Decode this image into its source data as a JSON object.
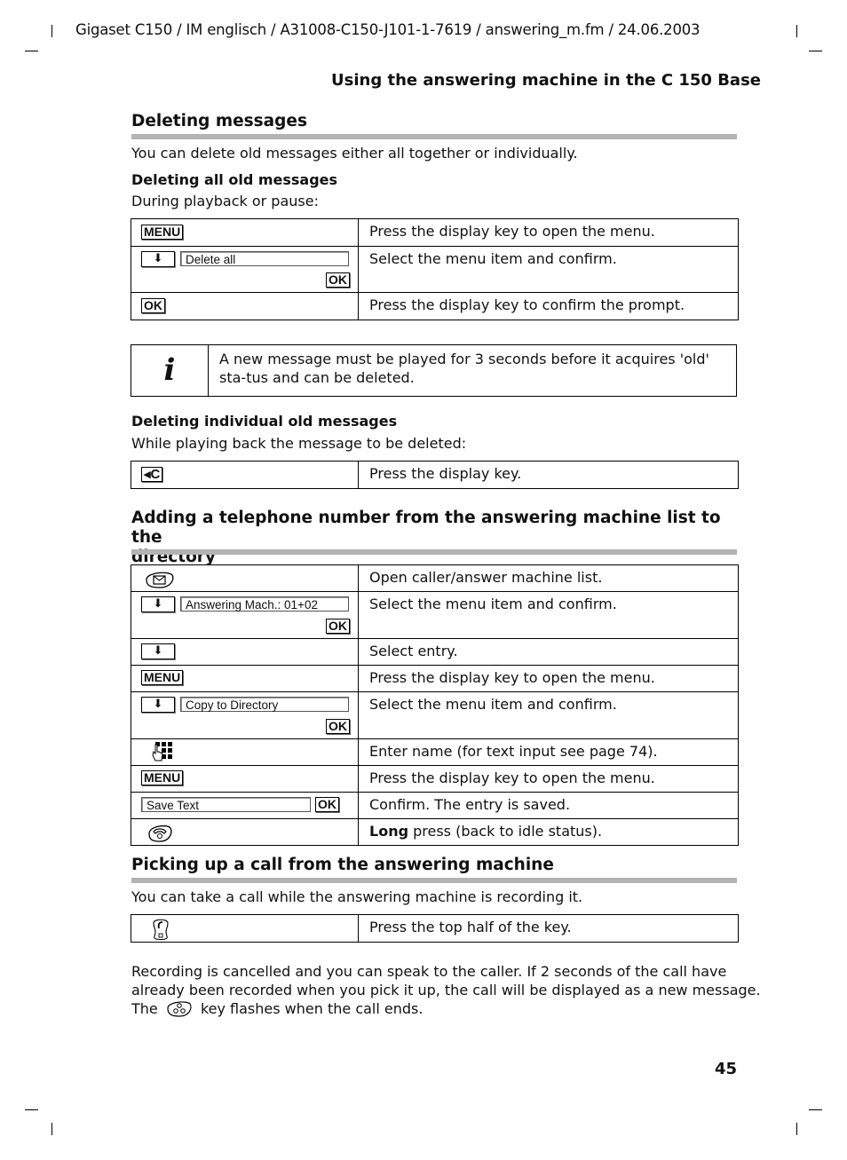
{
  "header": {
    "doc_info": "Gigaset C150 / IM englisch / A31008-C150-J101-1-7619 / answering_m.fm / 24.06.2003",
    "running_title": "Using the answering machine in the C 150 Base"
  },
  "section_delete": {
    "title": "Deleting messages",
    "intro": "You can delete old messages either all together or individually.",
    "all": {
      "title": "Deleting all old messages",
      "intro": "During playback or pause:",
      "steps": [
        {
          "key": "MENU",
          "desc": "Press the display key to open the menu."
        },
        {
          "arrow": "down-arrow-key",
          "field": "Delete all",
          "ok": "OK",
          "desc": "Select the menu item and confirm."
        },
        {
          "key": "OK",
          "desc": "Press the display key to confirm the prompt."
        }
      ]
    },
    "info_note": {
      "icon": "i",
      "text": "A new message must be played for 3 seconds before it acquires 'old' sta-tus and can be deleted."
    },
    "individual": {
      "title": "Deleting individual old messages",
      "intro": "While playing back the message to be deleted:",
      "steps": [
        {
          "key": "◂C",
          "desc": "Press the display key."
        }
      ]
    }
  },
  "section_add": {
    "title_line1": "Adding a telephone number from the answering machine list to the",
    "title_line2": "directory",
    "steps": [
      {
        "icon": "message-key-icon",
        "desc": "Open caller/answer machine list."
      },
      {
        "arrow": "down-arrow-key",
        "field": "Answering Mach.:  01+02",
        "ok": "OK",
        "desc": "Select the menu item and confirm."
      },
      {
        "arrow": "down-arrow-key",
        "desc": "Select entry."
      },
      {
        "key": "MENU",
        "desc": "Press the display key to open the menu."
      },
      {
        "arrow": "down-arrow-key",
        "field": "Copy to Directory",
        "ok": "OK",
        "desc": "Select the menu item and confirm."
      },
      {
        "icon": "keypad-icon",
        "desc": "Enter name (for text input see page 74)."
      },
      {
        "key": "MENU",
        "desc": "Press the display key to open the menu."
      },
      {
        "field": "Save Text",
        "ok": "OK",
        "desc": "Confirm. The entry is saved."
      },
      {
        "icon": "end-call-key-icon",
        "desc_bold": "Long",
        "desc": " press (back to idle status)."
      }
    ]
  },
  "section_pickup": {
    "title": "Picking up a call from the answering machine",
    "intro": "You can take a call while the answering machine is recording it.",
    "steps": [
      {
        "icon": "handsfree-talk-key-icon",
        "desc": "Press the top half of the key."
      }
    ],
    "para_line1": "Recording is cancelled and you can speak to the caller. If 2 seconds of the call have",
    "para_line2": "already been recorded when you pick it up, the call will be displayed as a new message.",
    "para_line3_pre": "The",
    "para_line3_post": "key flashes when the call ends."
  },
  "footer": {
    "page_number": "45"
  }
}
